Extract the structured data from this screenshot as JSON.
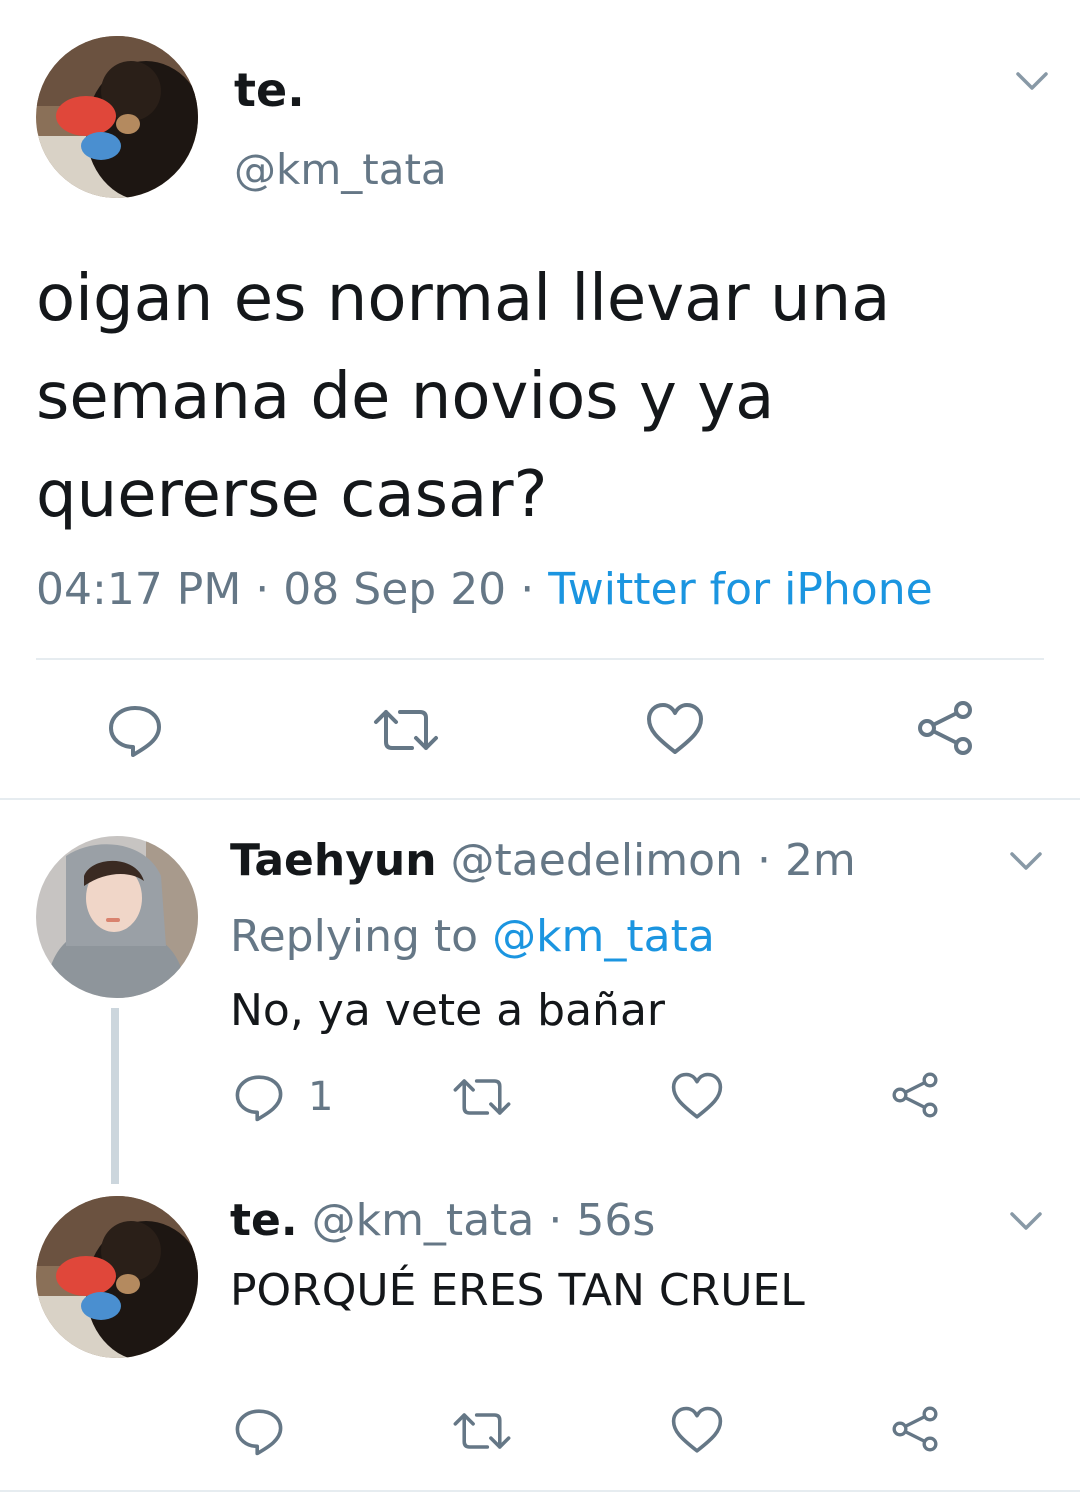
{
  "main_tweet": {
    "display_name": "te.",
    "handle": "@km_tata",
    "text": "oigan es normal llevar una semana de novios y ya quererse casar?",
    "time": "04:17 PM",
    "sep": "·",
    "date": "08 Sep 20",
    "source": "Twitter for iPhone"
  },
  "replies": [
    {
      "display_name": "Taehyun",
      "handle": "@taedelimon",
      "sep": "·",
      "time": "2m",
      "replying_prefix": "Replying to",
      "replying_handle": "@km_tata",
      "text": "No, ya vete a bañar",
      "reply_count": "1"
    },
    {
      "display_name": "te.",
      "handle": "@km_tata",
      "sep": "·",
      "time": "56s",
      "text": "PORQUÉ ERES TAN CRUEL"
    }
  ],
  "icons": {
    "reply": "reply-icon",
    "retweet": "retweet-icon",
    "like": "heart-icon",
    "share": "share-icon",
    "menu": "chevron-down-icon"
  },
  "colors": {
    "link": "#1b95e0",
    "secondary_text": "#657786",
    "icon": "#657786",
    "divider": "#e6ecf0",
    "thread_line": "#ccd6dd"
  }
}
